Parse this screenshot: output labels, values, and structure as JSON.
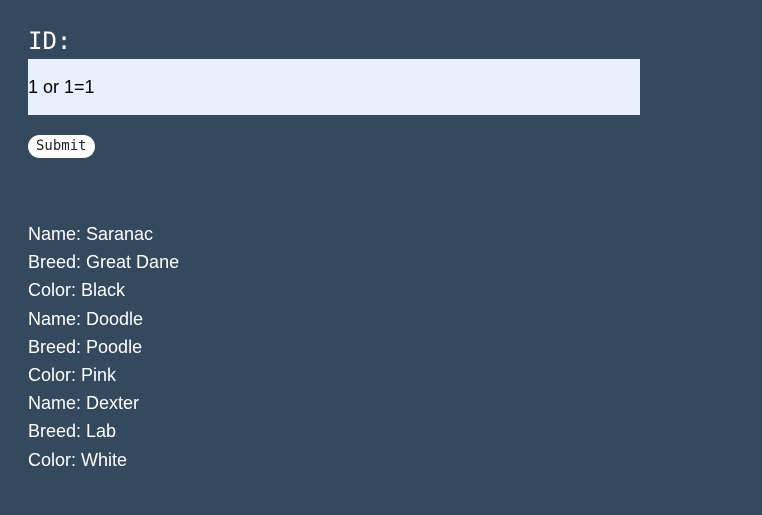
{
  "form": {
    "id_label": "ID:",
    "id_value": "1 or 1=1",
    "submit_label": "Submit"
  },
  "results": [
    "Name: Saranac",
    "Breed: Great Dane",
    "Color: Black",
    "Name: Doodle",
    "Breed: Poodle",
    "Color: Pink",
    "Name: Dexter",
    "Breed: Lab",
    "Color: White"
  ],
  "colors": {
    "background": "#35495e",
    "input_background": "#e8f0fe",
    "text": "#ffffff"
  }
}
